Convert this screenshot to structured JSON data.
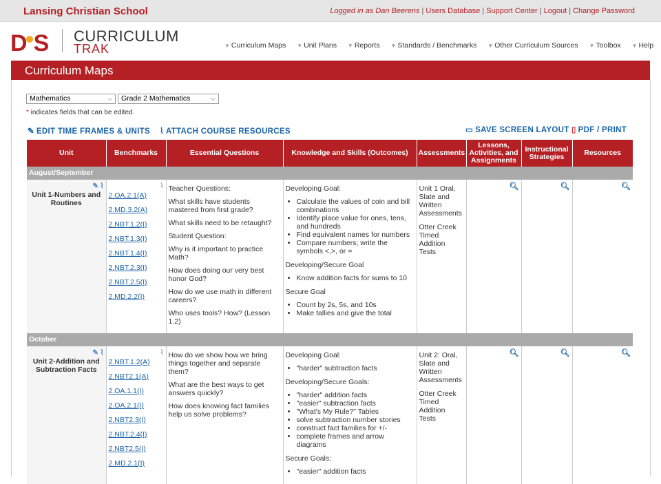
{
  "header": {
    "school": "Lansing Christian School",
    "logged_in": "Logged in as Dan Beerens",
    "links": [
      "Users Database",
      "Support Center",
      "Logout",
      "Change Password"
    ]
  },
  "logo": {
    "mark": "DS",
    "word1": "CURRICULUM",
    "word2": "TRAK"
  },
  "nav": [
    "Curriculum Maps",
    "Unit Plans",
    "Reports",
    "Standards / Benchmarks",
    "Other Curriculum Sources",
    "Toolbox",
    "Help"
  ],
  "page_title": "Curriculum Maps",
  "filters": {
    "subject": "Mathematics",
    "course": "Grade 2 Mathematics"
  },
  "note": {
    "star": "*",
    "text": " indicates fields that can be edited."
  },
  "actions": {
    "edit": "EDIT TIME FRAMES & UNITS",
    "attach": "ATTACH COURSE RESOURCES",
    "save": "SAVE SCREEN LAYOUT",
    "pdf": "PDF / PRINT"
  },
  "columns": [
    "Unit",
    "Benchmarks",
    "Essential Questions",
    "Knowledge and Skills (Outcomes)",
    "Assessments",
    "Lessons, Activities, and Assignments",
    "Instructional Strategies",
    "Resources"
  ],
  "timeframes": [
    {
      "name": "August/September",
      "unit": "Unit 1-Numbers and Routines",
      "benchmarks": [
        "2.OA.2.1(A)",
        "2.MD.3.2(A)",
        "2.NBT.1.2(I)",
        "2.NBT.1.3(I)",
        "2.NBT.1.4(I)",
        "2.NBT.2.3(I)",
        "2.NBT.2.5(I)",
        "2.MD.2.2(I)"
      ],
      "questions": [
        "Teacher Questions:",
        "What skills have students mastered from first grade?",
        "What skills need to be retaught?",
        "Student Question:",
        "Why is it important to practice Math?",
        "How does doing our very best honor God?",
        "How do we use math in different careers?",
        "Who uses tools? How? (Lesson 1.2)"
      ],
      "skills": [
        {
          "heading": "Developing Goal:",
          "items": [
            "Calculate the values of coin and bill combinations",
            "Identify place value for ones, tens, and hundreds",
            "Find equivalent names for numbers",
            "Compare numbers; write the symbols <,>, or ="
          ]
        },
        {
          "heading": "Developing/Secure Goal",
          "items": [
            "Know addition facts for sums to 10"
          ]
        },
        {
          "heading": "Secure Goal",
          "items": [
            "Count by 2s, 5s, and 10s",
            "Make tallies and give the total"
          ]
        }
      ],
      "assessments": [
        "Unit 1  Oral, Slate and Written Assessments",
        "Otter Creek Timed Addition Tests"
      ]
    },
    {
      "name": "October",
      "unit": "Unit 2-Addition and Subtraction Facts",
      "benchmarks": [
        "2.NBT.1.2(A)",
        "2.NBT2.1(A)",
        "2.OA.1.1(I)",
        "2.OA.2.1(I)",
        "2.NBT2.3(I)",
        "2.NBT.2.4(I)",
        "2.NBT2.5(I)",
        "2.MD.2.1(I)"
      ],
      "questions": [
        "How do we show how we bring things together and separate them?",
        "What are the best ways to get answers quickly?",
        "How does knowing fact families help us solve problems?"
      ],
      "skills": [
        {
          "heading": "Developing Goal:",
          "items": [
            "\"harder\" subtraction facts"
          ]
        },
        {
          "heading": "Developing/Secure Goals:",
          "items": [
            "\"harder\" addition facts",
            "\"easier\" subtraction facts",
            "\"What's My Rule?\" Tables",
            "solve subtraction number stories",
            "construct fact families for +/-",
            "complete frames and arrow diagrams"
          ]
        },
        {
          "heading": "Secure Goals:",
          "items": [
            "\"easier\" addition facts"
          ]
        }
      ],
      "assessments": [
        "Unit 2: Oral, Slate and Written Assessments",
        "Otter Creek Timed Addition Tests"
      ]
    }
  ],
  "colors": {
    "brand": "#b52025",
    "link": "#1a64a8",
    "timeframe_bar": "#aaaaaa"
  }
}
